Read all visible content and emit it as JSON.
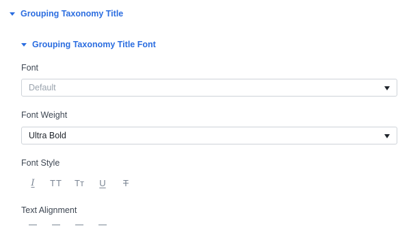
{
  "sections": {
    "outer_title": "Grouping Taxonomy Title",
    "inner_title": "Grouping Taxonomy Title Font"
  },
  "font": {
    "label": "Font",
    "value": "Default"
  },
  "font_weight": {
    "label": "Font Weight",
    "value": "Ultra Bold"
  },
  "font_style": {
    "label": "Font Style",
    "buttons": [
      {
        "icon": "italic-icon",
        "glyph": "I"
      },
      {
        "icon": "uppercase-icon",
        "glyph": "TT"
      },
      {
        "icon": "capitalize-icon",
        "glyph": "Tт"
      },
      {
        "icon": "underline-icon",
        "glyph": "U"
      },
      {
        "icon": "strikethrough-icon",
        "glyph": "T"
      }
    ]
  },
  "text_alignment": {
    "label": "Text Alignment",
    "buttons": [
      {
        "icon": "align-left-icon"
      },
      {
        "icon": "align-center-icon"
      },
      {
        "icon": "align-right-icon"
      },
      {
        "icon": "align-justify-icon"
      }
    ]
  },
  "colors": {
    "accent": "#2b6de0",
    "label_text": "#3d4652",
    "placeholder_text": "#9aa3ad",
    "icon": "#7a8593",
    "border": "#cdd2d8"
  }
}
